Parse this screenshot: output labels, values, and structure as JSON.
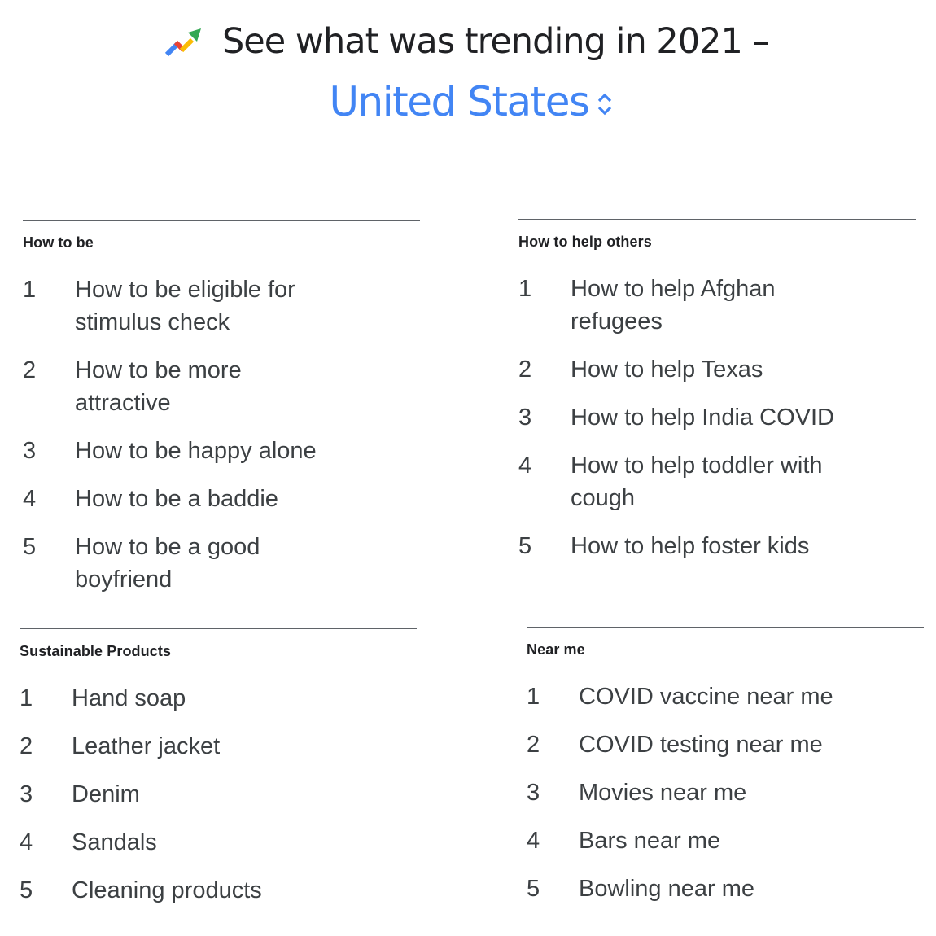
{
  "header": {
    "icon": "trending-arrow-icon",
    "title": "See what was trending in 2021 –",
    "region": "United States",
    "region_selector_icon": "up-down-chevron-icon",
    "colors": {
      "title": "#202124",
      "region": "#4285f4",
      "icon_blue": "#4285f4",
      "icon_red": "#ea4335",
      "icon_yellow": "#fbbc04",
      "icon_green": "#34a853"
    }
  },
  "sections": [
    {
      "title": "How to be",
      "items": [
        {
          "rank": "1",
          "text": "How to be eligible for stimulus check"
        },
        {
          "rank": "2",
          "text": "How to be more attractive"
        },
        {
          "rank": "3",
          "text": "How to be happy alone"
        },
        {
          "rank": "4",
          "text": "How to be a baddie"
        },
        {
          "rank": "5",
          "text": "How to be a good boyfriend"
        }
      ]
    },
    {
      "title": "How to help others",
      "items": [
        {
          "rank": "1",
          "text": "How to help Afghan refugees"
        },
        {
          "rank": "2",
          "text": "How to help Texas"
        },
        {
          "rank": "3",
          "text": "How to help India COVID"
        },
        {
          "rank": "4",
          "text": "How to help toddler with cough"
        },
        {
          "rank": "5",
          "text": "How to help foster kids"
        }
      ]
    },
    {
      "title": "Sustainable Products",
      "items": [
        {
          "rank": "1",
          "text": "Hand soap"
        },
        {
          "rank": "2",
          "text": "Leather jacket"
        },
        {
          "rank": "3",
          "text": "Denim"
        },
        {
          "rank": "4",
          "text": "Sandals"
        },
        {
          "rank": "5",
          "text": "Cleaning products"
        }
      ]
    },
    {
      "title": "Near me",
      "items": [
        {
          "rank": "1",
          "text": "COVID vaccine near me"
        },
        {
          "rank": "2",
          "text": "COVID testing near me"
        },
        {
          "rank": "3",
          "text": "Movies near me"
        },
        {
          "rank": "4",
          "text": "Bars near me"
        },
        {
          "rank": "5",
          "text": "Bowling near me"
        }
      ]
    }
  ]
}
